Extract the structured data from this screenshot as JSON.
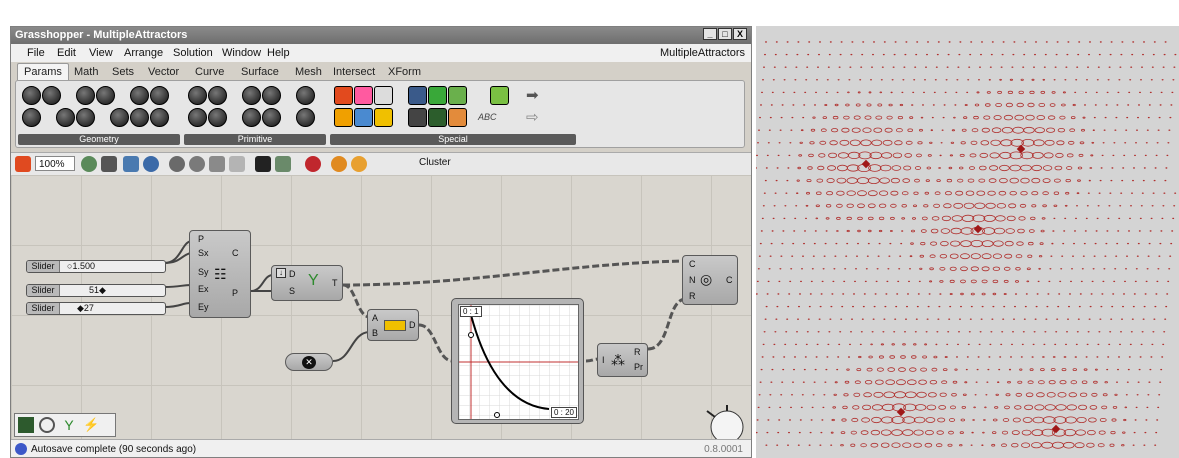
{
  "window": {
    "title": "Grasshopper - MultipleAttractors",
    "controls": [
      "_",
      "□",
      "X"
    ],
    "document_name": "MultipleAttractors"
  },
  "menu": [
    "File",
    "Edit",
    "View",
    "Arrange",
    "Solution",
    "Window",
    "Help"
  ],
  "tabs": [
    "Params",
    "Math",
    "Sets",
    "Vector",
    "Curve",
    "Surface",
    "Mesh",
    "Intersect",
    "XForm"
  ],
  "active_tab": "Params",
  "ribbon_groups": [
    "Geometry",
    "Primitive",
    "Special"
  ],
  "ribbon_special_text": "ABC",
  "canvas_toolbar": {
    "zoom": "100%",
    "cluster_label": "Cluster"
  },
  "sliders": [
    {
      "name": "Slider",
      "value": "1.500"
    },
    {
      "name": "Slider",
      "value": "51"
    },
    {
      "name": "Slider",
      "value": "27"
    }
  ],
  "components": {
    "plane_surface": {
      "inputs": [
        "P",
        "Sx",
        "Sy",
        "Ex",
        "Ey"
      ],
      "outputs": [
        "C",
        "P"
      ]
    },
    "populate": {
      "inputs": [
        "D",
        "S"
      ],
      "outputs": [
        "T"
      ]
    },
    "distance": {
      "inputs": [
        "A",
        "B"
      ],
      "outputs": [
        "D"
      ]
    },
    "pull": {
      "inputs": [
        "C",
        "N",
        "R"
      ],
      "outputs": [
        "C"
      ]
    },
    "remap": {
      "inputs": [
        "I"
      ],
      "outputs": [
        "R",
        "Pr"
      ]
    }
  },
  "graph": {
    "top_left_tag": "0 : 1",
    "bottom_right_tag": "0 : 20"
  },
  "status": {
    "text": "Autosave complete (90 seconds ago)",
    "version": "0.8.0001"
  },
  "colors": {
    "titlebar": "#7a7a7a",
    "canvas": "#d9d6cf",
    "curve": "#000000",
    "circles": "#b0302e",
    "viewport": "#d4d4d4"
  }
}
